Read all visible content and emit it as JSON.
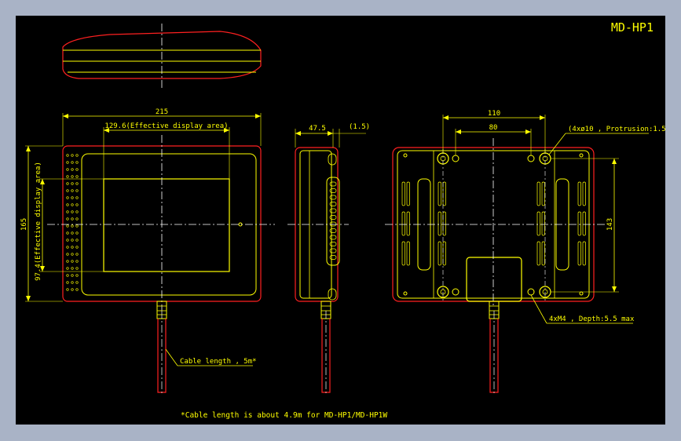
{
  "drawing": {
    "title": "MD-HP1",
    "dimensions": {
      "overall_width": "215",
      "effective_width": "129.6(Effective display area)",
      "overall_height": "165",
      "effective_height": "97.4(Effective display area)",
      "depth": "47.5",
      "protrusion": "(1.5)",
      "back_outer_spacing": "110",
      "back_inner_spacing": "80",
      "back_height": "143"
    },
    "callouts": {
      "bosses": "(4xø10 , Protrusion:1.5)",
      "screws": "4xM4 , Depth:5.5 max",
      "cable": "Cable length , 5m*"
    },
    "footnote": "*Cable length is about 4.9m for MD-HP1/MD-HP1W"
  },
  "colors": {
    "outline": "#ffff00",
    "shell": "#ff2020",
    "centerline": "#ffffff",
    "background": "#000000",
    "window_border": "#a9b3c6"
  }
}
